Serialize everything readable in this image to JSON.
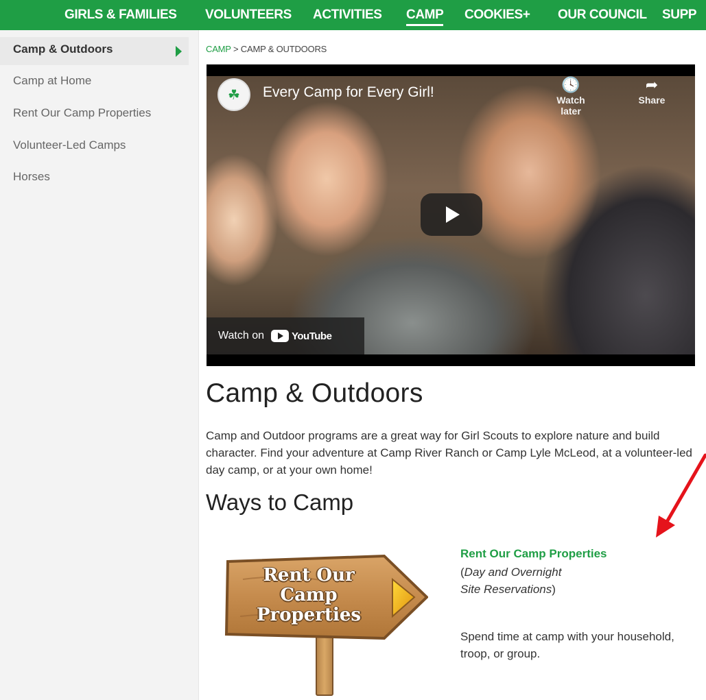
{
  "top_nav": {
    "items": [
      "GIRLS & FAMILIES",
      "VOLUNTEERS",
      "ACTIVITIES",
      "CAMP",
      "COOKIES+",
      "OUR COUNCIL",
      "SUPP"
    ],
    "active": "CAMP"
  },
  "sidebar": {
    "items": [
      "Camp & Outdoors",
      "Camp at Home",
      "Rent Our Camp Properties",
      "Volunteer-Led Camps",
      "Horses"
    ]
  },
  "breadcrumb": {
    "parent": "CAMP",
    "separator": ">",
    "current": "CAMP & OUTDOORS"
  },
  "video": {
    "title": "Every Camp for Every Girl!",
    "watch_later": "Watch later",
    "share": "Share",
    "watch_on": "Watch on",
    "youtube": "YouTube"
  },
  "content": {
    "heading": "Camp & Outdoors",
    "intro": "Camp and Outdoor programs are a great way for Girl Scouts to explore nature and build character. Find your adventure at Camp River Ranch or Camp Lyle McLeod, at a volunteer-led day camp, or at your own home!",
    "subheading": "Ways to Camp"
  },
  "way_to_camp": {
    "sign_lines": [
      "Rent Our",
      "Camp",
      "Properties"
    ],
    "link_title": "Rent Our Camp Properties",
    "subtitle_open": "(",
    "subtitle_line1": "Day and Overnight",
    "subtitle_line2": "Site Reservations",
    "subtitle_close": ")",
    "description": "Spend time at camp with your household, troop, or group."
  },
  "colors": {
    "brand_green": "#1f9e45",
    "annotation_red": "#e5131b"
  }
}
